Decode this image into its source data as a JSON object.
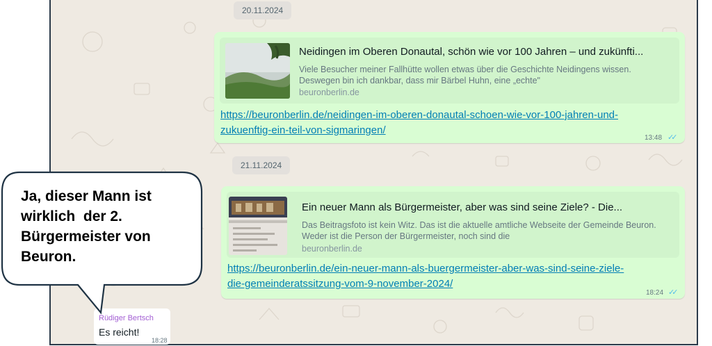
{
  "chat": {
    "dates": [
      "20.11.2024",
      "21.11.2024"
    ],
    "messages": [
      {
        "preview_title": "Neidingen im Oberen Donautal, schön wie vor 100 Jahren – und zukünfti...",
        "preview_desc": "Viele Besucher meiner Fallhütte wollen etwas über die Geschichte Neidingens wissen. Deswegen bin ich dankbar, dass mir Bärbel Huhn, eine „echte\"",
        "preview_domain": "beuronberlin.de",
        "link_line1": "https://beuronberlin.de/neidingen-im-oberen-donautal-schoen-wie-vor-100-jahren-und-",
        "link_line2": "zukuenftig-ein-teil-von-sigmaringen/",
        "time": "13:48"
      },
      {
        "preview_title": "Ein neuer Mann als Bürgermeister, aber was sind seine Ziele? - Die...",
        "preview_desc": "Das Beitragsfoto ist kein Witz. Das ist die aktuelle amtliche Webseite der Gemeinde Beuron. Weder ist die Person der Bürgermeister, noch sind die",
        "preview_domain": "beuronberlin.de",
        "link_line1": "https://beuronberlin.de/ein-neuer-mann-als-buergermeister-aber-was-sind-seine-ziele-",
        "link_line2": "die-gemeinderatssitzung-vom-9-november-2024/",
        "time": "18:24"
      }
    ],
    "incoming": {
      "sender": "Rüdiger Bertsch",
      "text": "Es reicht!",
      "time": "18:28"
    },
    "tick_glyph": "✓✓"
  },
  "callout": {
    "lines": [
      "Ja, dieser Mann ist",
      "wirklich  der 2.",
      "Bürgermeister von",
      "Beuron."
    ]
  },
  "colors": {
    "chat_bg": "#efeae2",
    "outgoing_bubble": "#d9fdd3",
    "link": "#027eb5",
    "ticks": "#53bdeb",
    "sender_name": "#a35fd3"
  }
}
